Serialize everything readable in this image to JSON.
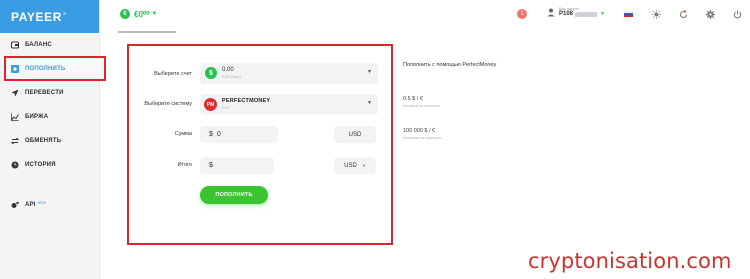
{
  "logo": {
    "text": "PAYEER",
    "reg": "®"
  },
  "nav": [
    {
      "icon": "bank-icon",
      "label": "БАЛАНС",
      "sup": ""
    },
    {
      "icon": "plus-square-icon",
      "label": "ПОПОЛНИТЬ",
      "sup": ""
    },
    {
      "icon": "send-icon",
      "label": "ПЕРЕВЕСТИ",
      "sup": ""
    },
    {
      "icon": "chart-icon",
      "label": "БИРЖА",
      "sup": ""
    },
    {
      "icon": "exchange-icon",
      "label": "ОБМЕНЯТЬ",
      "sup": ""
    },
    {
      "icon": "clock-icon",
      "label": "ИСТОРИЯ",
      "sup": ""
    },
    {
      "icon": "api-icon",
      "label": "API",
      "sup": "NEW"
    }
  ],
  "topbar": {
    "balance": "€0⁰⁰",
    "notifications": "1",
    "user_caption": "Ваш аккаунт",
    "user_id": "P108",
    "icons": [
      "flag-icon",
      "sun-icon",
      "refresh-icon",
      "gear-icon",
      "power-icon"
    ]
  },
  "form": {
    "account_label": "Выберите счет",
    "account_value": "0.00",
    "account_sub": "EUR (Евро)",
    "system_label": "Выберите систему",
    "system_value": "PERFECTMONEY",
    "system_sub": "EUR",
    "pm_logo": "PM",
    "amount_label": "Сумма",
    "amount_symbol": "$",
    "amount_value": "0",
    "amount_currency": "USD",
    "total_label": "Итого",
    "total_symbol": "$",
    "total_currency": "USD",
    "submit_label": "ПОПОЛНИТЬ"
  },
  "info": {
    "title": "Пополнить с помощью PerfectMoney",
    "fee_value": "0.5 $ / €",
    "fee_caption": "Минимум за операцию",
    "limit_value": "100 000 $ / €",
    "limit_caption": "Максимум за операцию"
  },
  "watermark": "cryptonisation.com",
  "colors": {
    "brand": "#3a9de3",
    "accent": "#27c24c",
    "highlight": "#d9252b"
  }
}
